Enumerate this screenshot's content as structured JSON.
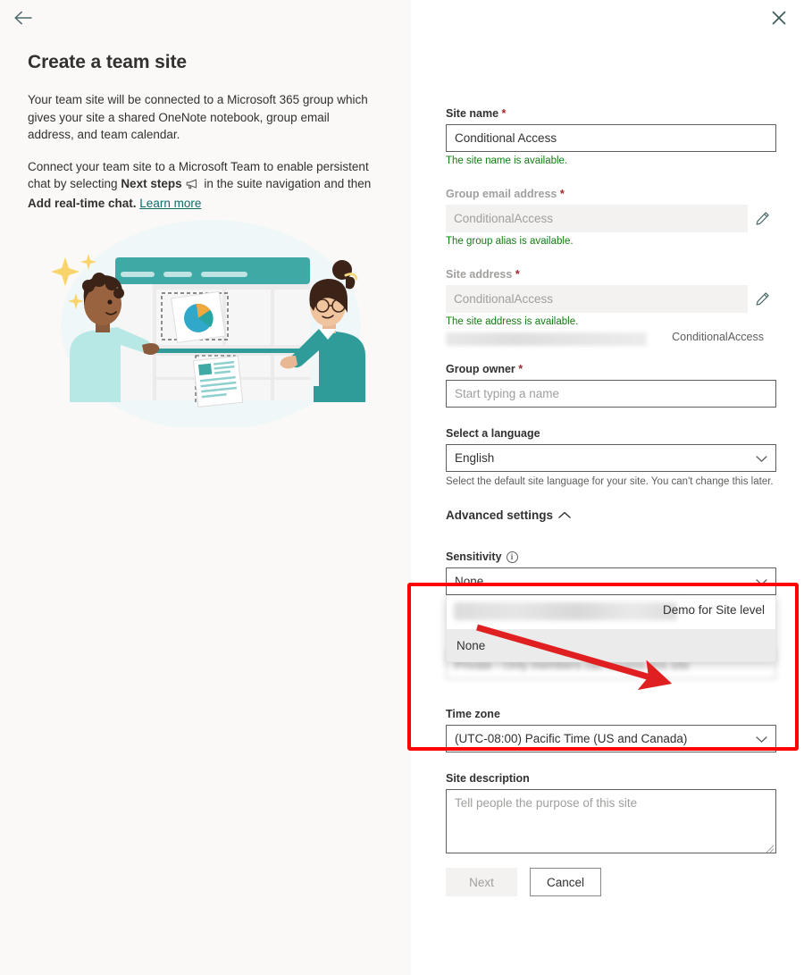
{
  "left": {
    "back_icon": "arrow-left-icon",
    "title": "Create a team site",
    "paragraph1": "Your team site will be connected to a Microsoft 365 group which gives your site a shared OneNote notebook, group email address, and team calendar.",
    "p2_a": "Connect your team site to a Microsoft Team to enable persistent chat by selecting ",
    "p2_bold1": "Next steps",
    "p2_b": " in the suite navigation and then ",
    "p2_bold2": "Add real-time chat.",
    "learn_more": "Learn more",
    "illustration_name": "team-collaboration-illustration"
  },
  "right": {
    "close_icon": "close-icon",
    "site_name": {
      "label": "Site name",
      "required": "*",
      "value": "Conditional Access",
      "helper": "The site name is available."
    },
    "group_email": {
      "label": "Group email address",
      "required": "*",
      "value": "ConditionalAccess",
      "helper": "The group alias is available.",
      "edit_icon": "pencil-icon"
    },
    "site_address": {
      "label": "Site address",
      "required": "*",
      "value": "ConditionalAccess",
      "helper": "The site address is available.",
      "url_tail": "ConditionalAccess",
      "edit_icon": "pencil-icon"
    },
    "group_owner": {
      "label": "Group owner",
      "required": "*",
      "placeholder": "Start typing a name"
    },
    "language": {
      "label": "Select a language",
      "value": "English",
      "helper": "Select the default site language for your site. You can't change this later.",
      "chevron_icon": "chevron-down-icon"
    },
    "advanced_settings": {
      "label": "Advanced settings",
      "chevron_icon": "chevron-up-icon"
    },
    "sensitivity": {
      "label": "Sensitivity",
      "info_icon": "info-icon",
      "value": "None",
      "chevron_icon": "chevron-down-icon",
      "options": [
        {
          "label": "",
          "redacted": true,
          "annotation": "Demo for Site level"
        },
        {
          "label": "None",
          "selected": true
        }
      ]
    },
    "privacy_hidden": {
      "value": "Private - Only members can access this site"
    },
    "time_zone": {
      "label": "Time zone",
      "value": "(UTC-08:00) Pacific Time (US and Canada)",
      "chevron_icon": "chevron-down-icon"
    },
    "site_description": {
      "label": "Site description",
      "placeholder": "Tell people the purpose of this site"
    },
    "buttons": {
      "next": "Next",
      "cancel": "Cancel"
    }
  },
  "annotation": {
    "box_color": "#ff0000",
    "arrow_color": "#e02020",
    "arrow_name": "red-arrow-pointing-to-demo-label"
  }
}
